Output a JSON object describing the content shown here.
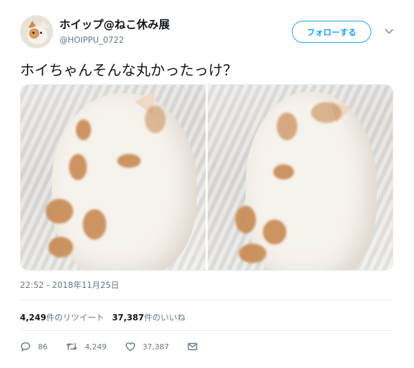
{
  "user": {
    "display_name": "ホイップ@ねこ休み展",
    "handle": "@HOIPPU_0722"
  },
  "follow_button": {
    "label": "フォローする"
  },
  "tweet": {
    "text": "ホイちゃんそんな丸かったっけ？",
    "timestamp": "22:52 - 2018年11月25日"
  },
  "stats": {
    "retweets_count": "4,249",
    "retweets_label": "件のリツイート",
    "likes_count": "37,387",
    "likes_label": "件のいいね"
  },
  "actions": {
    "replies": "86",
    "retweets": "4,249",
    "likes": "37,387"
  },
  "colors": {
    "accent": "#1da1f2",
    "text_primary": "#14171a",
    "text_secondary": "#657786",
    "divider": "#e6ecf0"
  },
  "icons": [
    "avatar",
    "chevron-down-icon",
    "reply-icon",
    "retweet-icon",
    "like-icon",
    "message-icon"
  ]
}
